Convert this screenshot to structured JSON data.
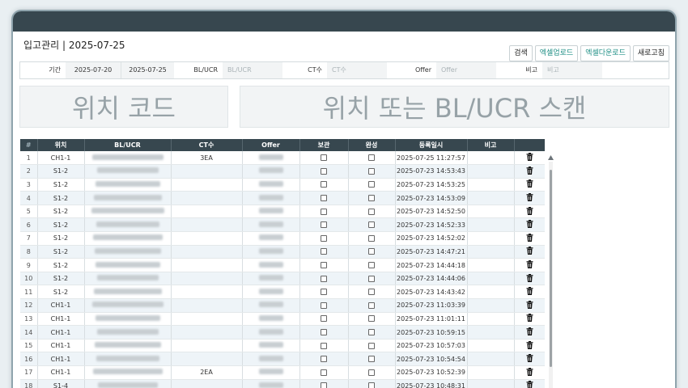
{
  "header": {
    "title": "입고관리 | 2025-07-25",
    "buttons": {
      "search": "검색",
      "upload": "엑셀업로드",
      "download": "엑셀다운로드",
      "refresh": "새로고침"
    }
  },
  "filters": {
    "period_label": "기간",
    "date_from": "2025-07-20",
    "date_to": "2025-07-25",
    "bl_label": "BL/UCR",
    "bl_placeholder": "BL/UCR",
    "ct_label": "CT수",
    "ct_placeholder": "CT수",
    "offer_label": "Offer",
    "offer_placeholder": "Offer",
    "note_label": "비고",
    "note_placeholder": "비고"
  },
  "scan": {
    "location_code": "위치 코드",
    "scan_prompt": "위치 또는 BL/UCR 스캔"
  },
  "table": {
    "columns": [
      "#",
      "위치",
      "BL/UCR",
      "CT수",
      "Offer",
      "보관",
      "완성",
      "등록일시",
      "비고"
    ],
    "rows": [
      {
        "no": "1",
        "loc": "CH1-1",
        "ct": "3EA",
        "date": "2025-07-25 11:27:57"
      },
      {
        "no": "2",
        "loc": "S1-2",
        "ct": "",
        "date": "2025-07-23 14:53:43"
      },
      {
        "no": "3",
        "loc": "S1-2",
        "ct": "",
        "date": "2025-07-23 14:53:25"
      },
      {
        "no": "4",
        "loc": "S1-2",
        "ct": "",
        "date": "2025-07-23 14:53:09"
      },
      {
        "no": "5",
        "loc": "S1-2",
        "ct": "",
        "date": "2025-07-23 14:52:50"
      },
      {
        "no": "6",
        "loc": "S1-2",
        "ct": "",
        "date": "2025-07-23 14:52:33"
      },
      {
        "no": "7",
        "loc": "S1-2",
        "ct": "",
        "date": "2025-07-23 14:52:02"
      },
      {
        "no": "8",
        "loc": "S1-2",
        "ct": "",
        "date": "2025-07-23 14:47:21"
      },
      {
        "no": "9",
        "loc": "S1-2",
        "ct": "",
        "date": "2025-07-23 14:44:18"
      },
      {
        "no": "10",
        "loc": "S1-2",
        "ct": "",
        "date": "2025-07-23 14:44:06"
      },
      {
        "no": "11",
        "loc": "S1-2",
        "ct": "",
        "date": "2025-07-23 14:43:42"
      },
      {
        "no": "12",
        "loc": "CH1-1",
        "ct": "",
        "date": "2025-07-23 11:03:39"
      },
      {
        "no": "13",
        "loc": "CH1-1",
        "ct": "",
        "date": "2025-07-23 11:01:11"
      },
      {
        "no": "14",
        "loc": "CH1-1",
        "ct": "",
        "date": "2025-07-23 10:59:15"
      },
      {
        "no": "15",
        "loc": "CH1-1",
        "ct": "",
        "date": "2025-07-23 10:57:03"
      },
      {
        "no": "16",
        "loc": "CH1-1",
        "ct": "",
        "date": "2025-07-23 10:54:54"
      },
      {
        "no": "17",
        "loc": "CH1-1",
        "ct": "2EA",
        "date": "2025-07-23 10:52:39"
      },
      {
        "no": "18",
        "loc": "S1-4",
        "ct": "",
        "date": "2025-07-23 10:48:31"
      }
    ]
  },
  "icons": {
    "row_action": "trash-icon"
  },
  "colors": {
    "header_bg": "#37474f",
    "accent_teal": "#1f8f85",
    "row_alt": "#eef4f8"
  }
}
